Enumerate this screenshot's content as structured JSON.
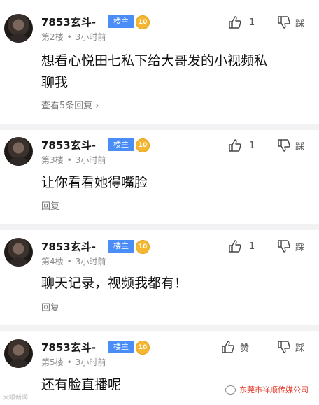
{
  "comments": [
    {
      "username": "7853玄斗-",
      "owner_badge": "楼主",
      "level": "10",
      "floor": "第2楼",
      "time": "3小时前",
      "likes": "1",
      "dislike_label": "踩",
      "text_lines": [
        "想看心悦田七私下给大哥发的小视频私",
        "聊我"
      ],
      "reply_label": "查看5条回复 ›"
    },
    {
      "username": "7853玄斗-",
      "owner_badge": "楼主",
      "level": "10",
      "floor": "第3楼",
      "time": "3小时前",
      "likes": "1",
      "dislike_label": "踩",
      "text_lines": [
        "让你看看她得嘴脸"
      ],
      "reply_label": "回复"
    },
    {
      "username": "7853玄斗-",
      "owner_badge": "楼主",
      "level": "10",
      "floor": "第4楼",
      "time": "3小时前",
      "likes": "1",
      "dislike_label": "踩",
      "text_lines": [
        "聊天记录，视频我都有！"
      ],
      "reply_label": "回复"
    },
    {
      "username": "7853玄斗-",
      "owner_badge": "楼主",
      "level": "10",
      "floor": "第5楼",
      "time": "3小时前",
      "likes": "赞",
      "dislike_label": "踩",
      "text_lines": [
        "还有脸直播呢"
      ],
      "reply_label": ""
    }
  ],
  "watermarks": {
    "left": "大眼新闻",
    "right": "东莞市祥顺传媒公司"
  },
  "colors": {
    "owner_badge": "#4a8df7",
    "level_badge": "#f5b731",
    "watermark_right": "#e23b2e"
  }
}
